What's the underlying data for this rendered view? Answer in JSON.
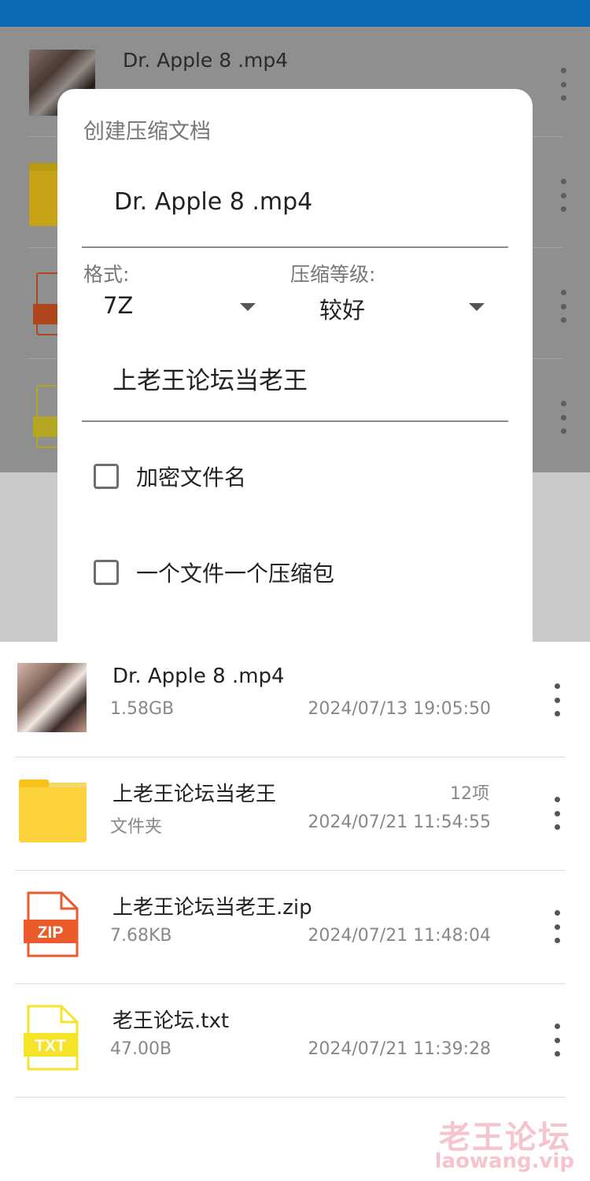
{
  "colors": {
    "status_bar": "#0a6ab6",
    "zip_accent": "#ea5a2a",
    "txt_accent": "#f5e42a",
    "folder_accent": "#fdd33d"
  },
  "background_list": [
    {
      "name": "Dr. Apple 8 .mp4",
      "icon": "video-thumbnail"
    },
    {
      "name": "",
      "icon": "folder-icon"
    },
    {
      "name": "",
      "icon": "zip-file-icon"
    },
    {
      "name": "",
      "icon": "txt-file-icon"
    }
  ],
  "dialog": {
    "title": "创建压缩文档",
    "filename_value": "Dr. Apple 8 .mp4",
    "format_label": "格式:",
    "format_value": "7Z",
    "level_label": "压缩等级:",
    "level_value": "较好",
    "password_value": "上老王论坛当老王",
    "encrypt_filenames_label": "加密文件名",
    "encrypt_filenames_checked": false,
    "one_archive_per_file_label": "一个文件一个压缩包",
    "one_archive_per_file_checked": false
  },
  "files": [
    {
      "name": "Dr. Apple 8 .mp4",
      "meta": "1.58GB",
      "date": "2024/07/13 19:05:50",
      "count": "",
      "icon": "video-thumbnail"
    },
    {
      "name": "上老王论坛当老王",
      "meta": "文件夹",
      "date": "2024/07/21 11:54:55",
      "count": "12项",
      "icon": "folder-icon"
    },
    {
      "name": "上老王论坛当老王.zip",
      "meta": "7.68KB",
      "date": "2024/07/21 11:48:04",
      "count": "",
      "icon": "zip-file-icon",
      "badge": "ZIP"
    },
    {
      "name": "老王论坛.txt",
      "meta": "47.00B",
      "date": "2024/07/21 11:39:28",
      "count": "",
      "icon": "txt-file-icon",
      "badge": "TXT"
    }
  ],
  "watermark": {
    "cn": "老王论坛",
    "en": "laowang.vip"
  }
}
